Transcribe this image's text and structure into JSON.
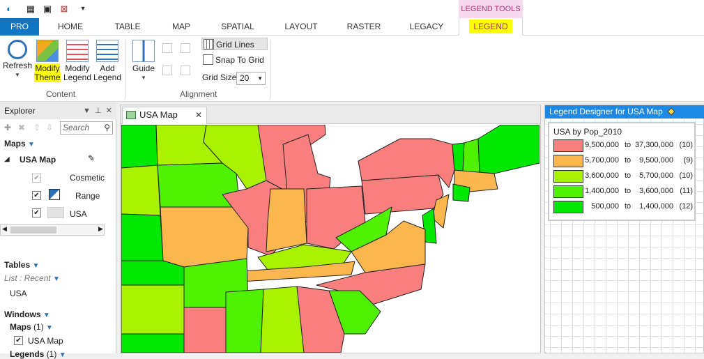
{
  "colors": {
    "class_9_5m_37_3m": "#f97f7f",
    "class_5_7m_9_5m": "#fbb64d",
    "class_3_6m_5_7m": "#a8f200",
    "class_1_4m_3_6m": "#4ff000",
    "class_0_5m_1_4m": "#00e800",
    "ribbon_accent": "#0f75c5",
    "highlight": "#ffff00",
    "legend_header": "#1e88e5"
  },
  "context_tab_group": "LEGEND TOOLS",
  "tabs": [
    "PRO",
    "HOME",
    "TABLE",
    "MAP",
    "SPATIAL",
    "LAYOUT",
    "RASTER",
    "LEGACY",
    "LEGEND"
  ],
  "ribbon": {
    "content": {
      "refresh": "Refresh",
      "modify_theme_1": "Modify",
      "modify_theme_2": "Theme",
      "modify_legend_1": "Modify",
      "modify_legend_2": "Legend",
      "add_legend_1": "Add",
      "add_legend_2": "Legend",
      "group_label": "Content"
    },
    "alignment": {
      "guide": "Guide",
      "grid_lines": "Grid Lines",
      "snap_to_grid": "Snap To Grid",
      "grid_size_label": "Grid Size",
      "grid_size_value": "20",
      "group_label": "Alignment"
    }
  },
  "explorer": {
    "title": "Explorer",
    "search_placeholder": "Search",
    "maps_header": "Maps",
    "map_name": "USA Map",
    "layers": [
      "Cosmetic",
      "Range",
      "USA"
    ],
    "tables_header": "Tables",
    "list_filter": "List : Recent",
    "tables": [
      "USA"
    ],
    "windows_header": "Windows",
    "windows_maps": "Maps",
    "windows_maps_count": "(1)",
    "window_items": [
      "USA Map"
    ],
    "legends_header": "Legends",
    "legends_count": "(1)"
  },
  "map_window": {
    "tab_label": "USA Map",
    "close_glyph": "✕"
  },
  "legend_designer": {
    "title": "Legend Designer for USA Map",
    "legend_title": "USA by Pop_2010",
    "rows": [
      {
        "low": "9,500,000",
        "sep": "to",
        "high": "37,300,000",
        "count": "(10)",
        "color_key": "class_9_5m_37_3m"
      },
      {
        "low": "5,700,000",
        "sep": "to",
        "high": "9,500,000",
        "count": "(9)",
        "color_key": "class_5_7m_9_5m"
      },
      {
        "low": "3,600,000",
        "sep": "to",
        "high": "5,700,000",
        "count": "(10)",
        "color_key": "class_3_6m_5_7m"
      },
      {
        "low": "1,400,000",
        "sep": "to",
        "high": "3,600,000",
        "count": "(11)",
        "color_key": "class_1_4m_3_6m"
      },
      {
        "low": "500,000",
        "sep": "to",
        "high": "1,400,000",
        "count": "(12)",
        "color_key": "class_0_5m_1_4m"
      }
    ]
  }
}
